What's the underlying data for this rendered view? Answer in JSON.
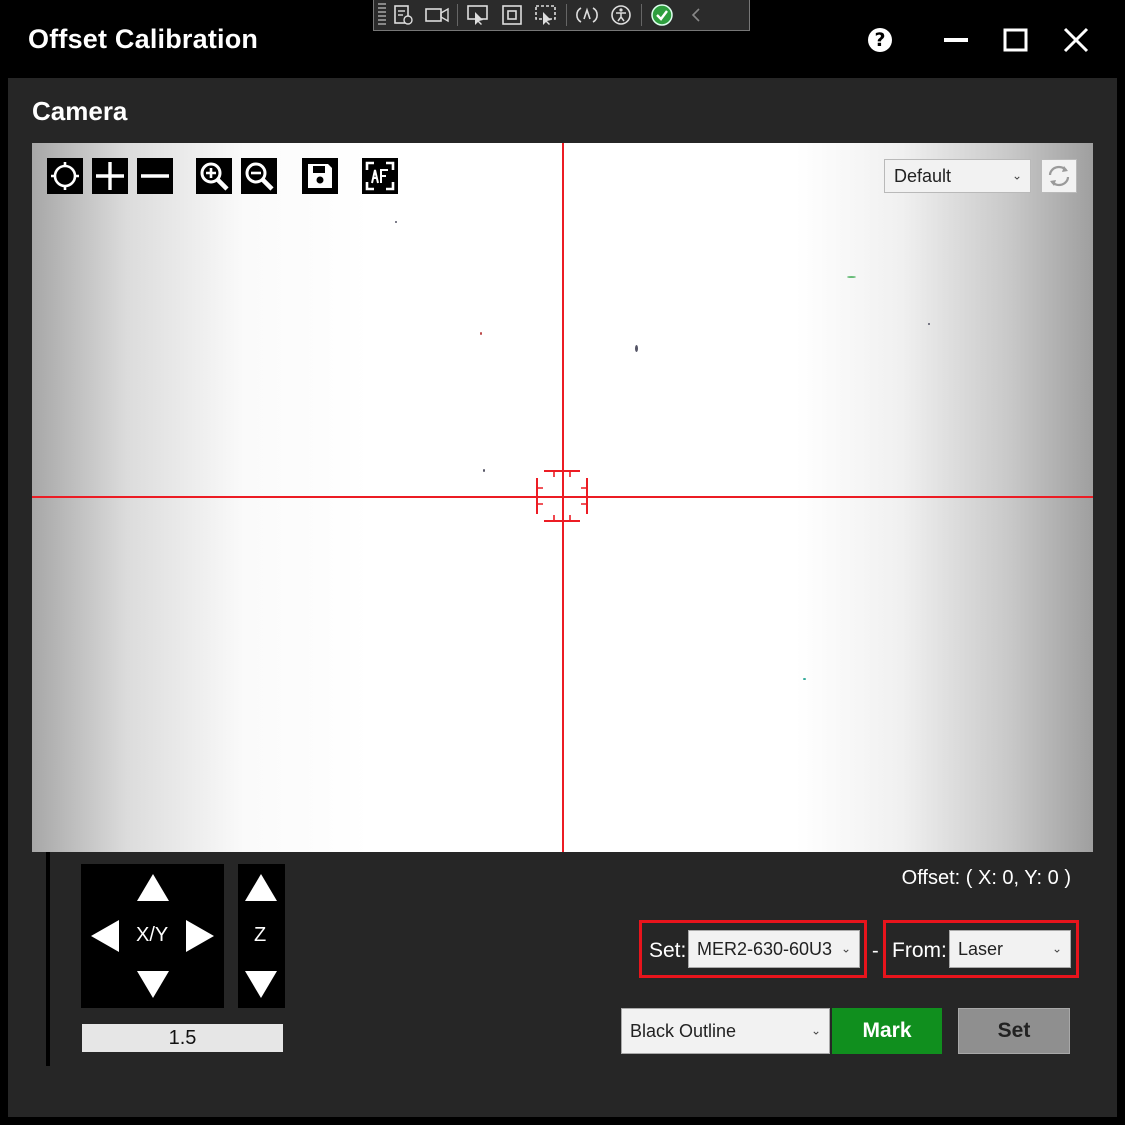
{
  "window": {
    "title": "Offset Calibration",
    "help_label": "?"
  },
  "camera": {
    "section_title": "Camera",
    "preset": {
      "selected": "Default"
    }
  },
  "jog": {
    "xy_label": "X/Y",
    "z_label": "Z",
    "step_value": "1.5"
  },
  "offset": {
    "text": "Offset: ( X: 0, Y: 0 )"
  },
  "set_group": {
    "label": "Set:",
    "selected": "MER2-630-60U3"
  },
  "separator": "-",
  "from_group": {
    "label": "From:",
    "selected": "Laser"
  },
  "mark_style": {
    "selected": "Black Outline"
  },
  "buttons": {
    "mark_label": "Mark",
    "set_label": "Set"
  },
  "colors": {
    "crosshair": "#ec1c24",
    "highlight": "#e8141c",
    "mark_button": "#108f1e",
    "set_button": "#8f8f8f",
    "panel": "#262626"
  },
  "icons": {
    "camera_tools": [
      "crosshair-target-icon",
      "plus-icon",
      "minus-icon",
      "zoom-in-icon",
      "zoom-out-icon",
      "save-icon",
      "autofocus-icon"
    ],
    "title_bar": [
      "help-icon",
      "minimize-icon",
      "maximize-icon",
      "close-icon"
    ],
    "debug_toolbar": [
      "live-visual-tree-icon",
      "record-icon",
      "select-element-icon",
      "display-layout-adorners-icon",
      "track-focus-icon",
      "hot-reload-icon",
      "accessibility-icon",
      "binding-ok-icon",
      "collapse-icon"
    ]
  }
}
